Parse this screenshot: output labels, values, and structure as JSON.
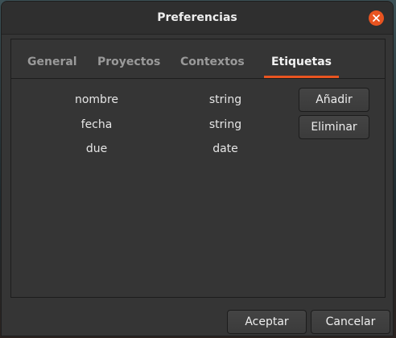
{
  "window": {
    "title": "Preferencias"
  },
  "tabs": [
    {
      "label": "General",
      "active": false
    },
    {
      "label": "Proyectos",
      "active": false
    },
    {
      "label": "Contextos",
      "active": false
    },
    {
      "label": "Etiquetas",
      "active": true
    }
  ],
  "tags": [
    {
      "name": "nombre",
      "type": "string"
    },
    {
      "name": "fecha",
      "type": "string"
    },
    {
      "name": "due",
      "type": "date"
    }
  ],
  "actions": {
    "add_label": "Añadir",
    "remove_label": "Eliminar"
  },
  "footer": {
    "accept_label": "Aceptar",
    "cancel_label": "Cancelar"
  },
  "icons": {
    "close": "close-icon"
  },
  "colors": {
    "accent": "#e95420",
    "window_bg": "#353535",
    "titlebar_bg": "#2f2f2f"
  }
}
